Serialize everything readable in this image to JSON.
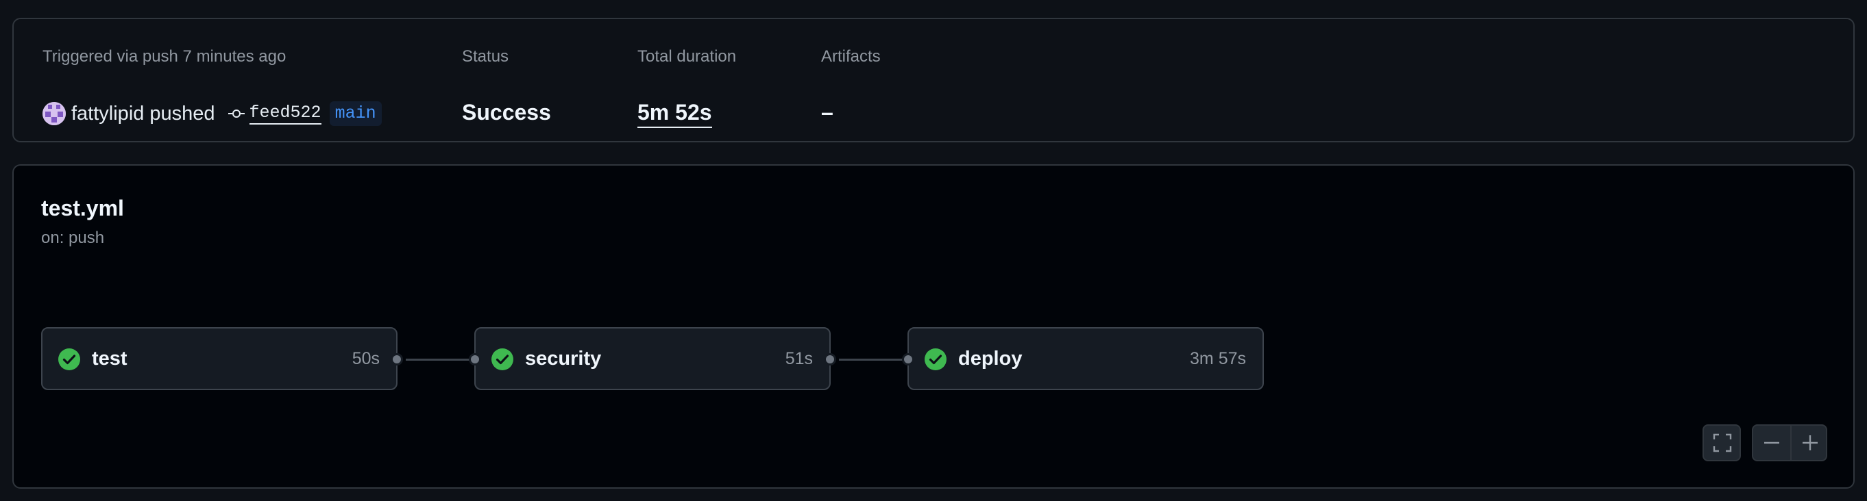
{
  "summary": {
    "trigger_label": "Triggered via push 7 minutes ago",
    "actor": "fattylipid",
    "action": "pushed",
    "commit_sha": "feed522",
    "branch": "main",
    "status_label": "Status",
    "status_value": "Success",
    "duration_label": "Total duration",
    "duration_value": "5m 52s",
    "artifacts_label": "Artifacts",
    "artifacts_value": "–"
  },
  "workflow": {
    "title": "test.yml",
    "trigger": "on: push",
    "jobs": [
      {
        "name": "test",
        "duration": "50s",
        "status": "success"
      },
      {
        "name": "security",
        "duration": "51s",
        "status": "success"
      },
      {
        "name": "deploy",
        "duration": "3m 57s",
        "status": "success"
      }
    ]
  },
  "colors": {
    "success": "#3fb950",
    "accent_link": "#4493f8",
    "background": "#0d1117"
  },
  "icons": {
    "job_status": "check-circle-icon",
    "commit": "git-commit-icon",
    "fullscreen": "fullscreen-icon",
    "zoom_out": "minus-icon",
    "zoom_in": "plus-icon"
  }
}
